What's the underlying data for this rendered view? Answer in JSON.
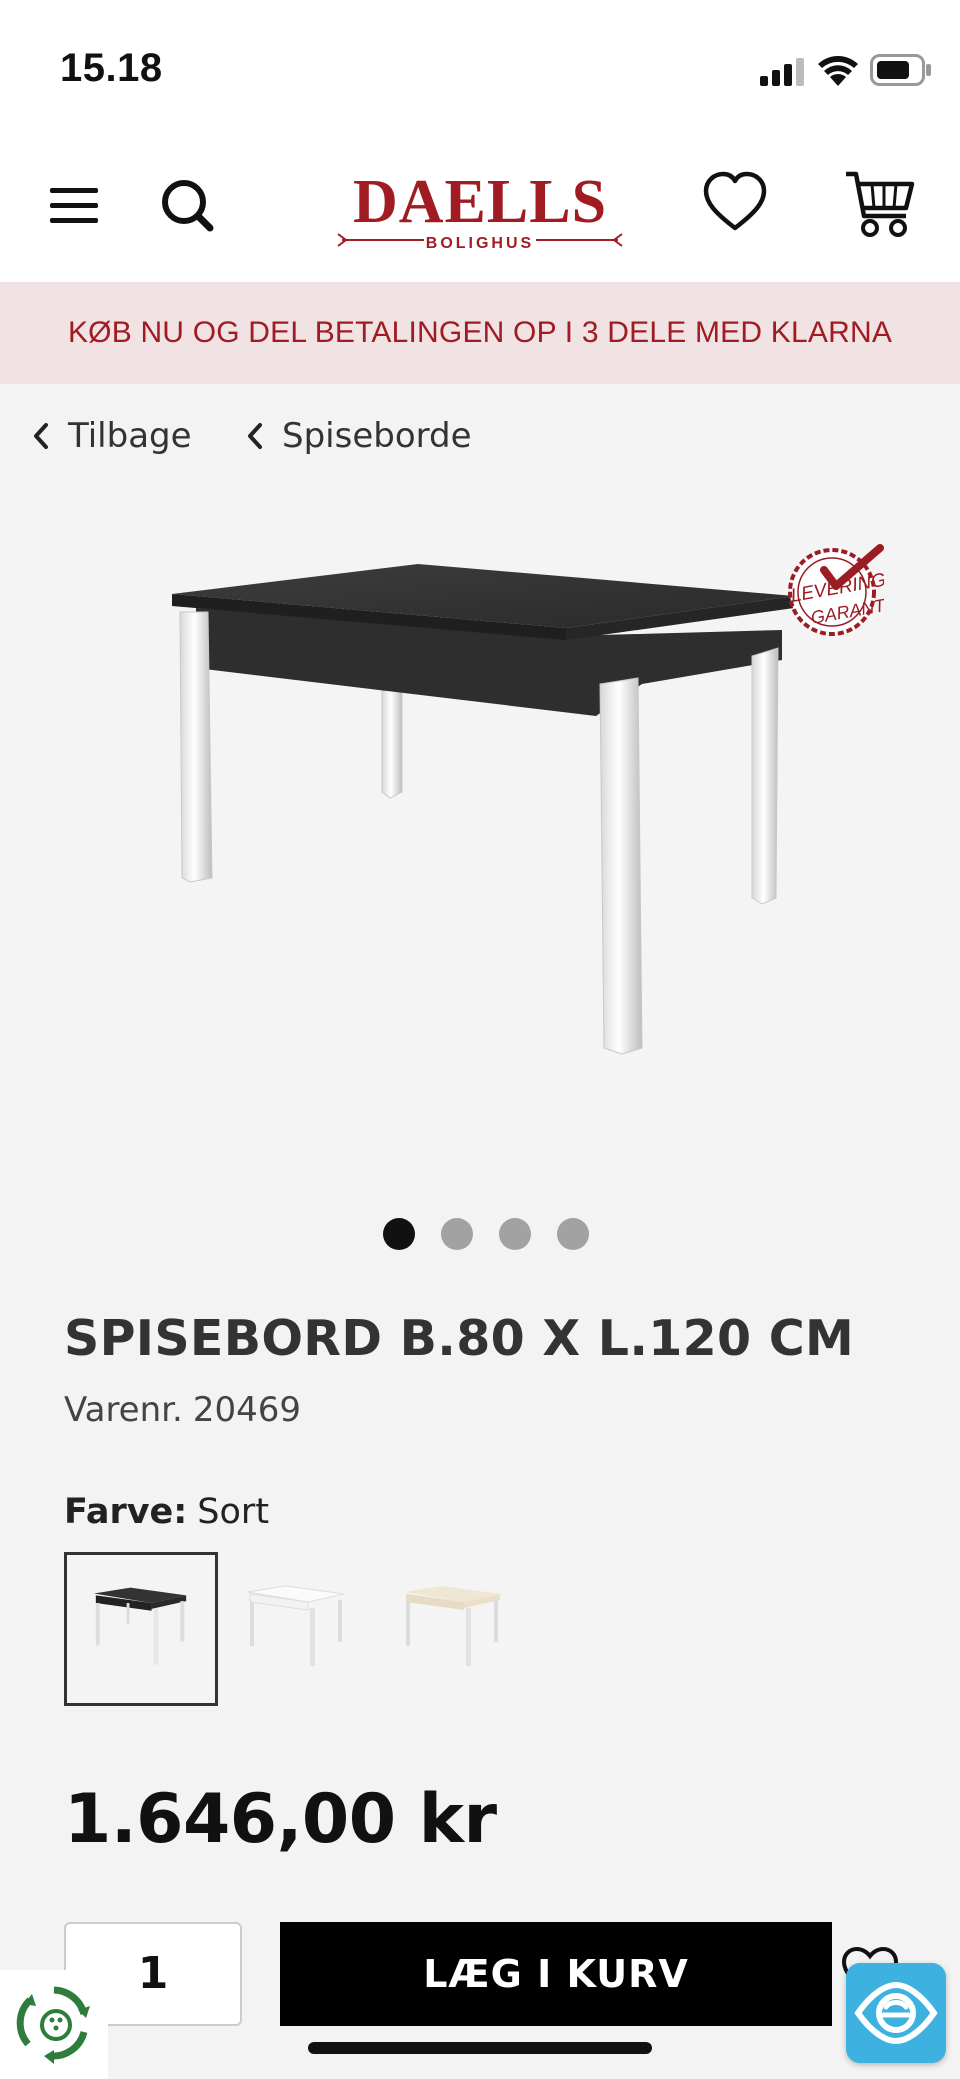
{
  "status_bar": {
    "time": "15.18"
  },
  "header": {
    "logo_text": "DAELLS",
    "logo_subtext": "BOLIGHUS",
    "brand_color": "#a01c22",
    "icons": [
      "menu-icon",
      "search-icon",
      "heart-icon",
      "cart-icon"
    ]
  },
  "promo": {
    "text": "KØB NU OG DEL BETALINGEN OP I 3 DELE MED KLARNA"
  },
  "breadcrumbs": {
    "back_label": "Tilbage",
    "category_label": "Spiseborde"
  },
  "gallery": {
    "badge_line1": "LEVERINGS",
    "badge_line2": "GARANTI",
    "slide_count": 4,
    "active_slide": 1
  },
  "product": {
    "title": "SPISEBORD B.80 X L.120 CM",
    "sku_label": "Varenr.",
    "sku": "20469",
    "color_label": "Farve:",
    "color_value": "Sort",
    "variants": [
      "Sort",
      "Hvid",
      "Eg"
    ],
    "price": "1.646,00 kr"
  },
  "purchase": {
    "quantity": "1",
    "add_to_cart_label": "LÆG I KURV"
  }
}
